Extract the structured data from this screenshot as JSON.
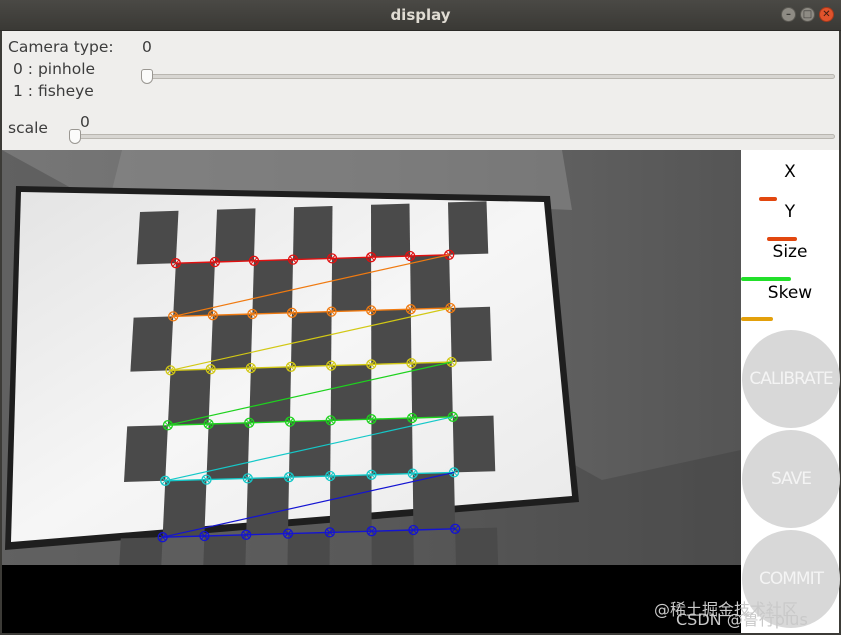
{
  "window": {
    "title": "display",
    "buttons": {
      "minimize_icon": "minimize-icon",
      "maximize_icon": "maximize-icon",
      "close_icon": "close-icon"
    }
  },
  "controls": {
    "camera_type_label": "Camera type:",
    "camera_type_value": "0",
    "option_pinhole": "0 : pinhole",
    "option_fisheye": "1 : fisheye",
    "camera_slider_fraction": 0,
    "scale_label": "scale",
    "scale_value": "0",
    "scale_slider_fraction": 0
  },
  "side_panel": {
    "metrics": [
      {
        "label": "X",
        "color": "#e2470f"
      },
      {
        "label": "Y",
        "color": "#e2470f"
      },
      {
        "label": "Size",
        "color": "#22e02a"
      },
      {
        "label": "Skew",
        "color": "#e3a00b"
      }
    ],
    "buttons": [
      "CALIBRATE",
      "SAVE",
      "COMMIT"
    ]
  },
  "feed": {
    "corner_row_colors": [
      "#e01010",
      "#f07a10",
      "#d2c814",
      "#1ed21e",
      "#14c8c8",
      "#1414d2"
    ]
  },
  "watermark": {
    "line1": "@稀土掘金技术社区",
    "line2": "CSDN @鲁行plus"
  }
}
